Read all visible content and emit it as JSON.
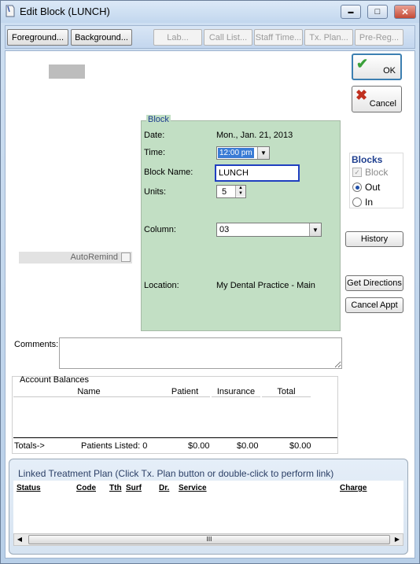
{
  "window": {
    "title": "Edit Block (LUNCH)",
    "controls": {
      "minimize": "▬",
      "maximize": "□",
      "close": "✕"
    }
  },
  "toolbar": {
    "foreground": "Foreground...",
    "background": "Background...",
    "lab": "Lab...",
    "call_list": "Call List...",
    "staff_time": "Staff Time...",
    "tx_plan": "Tx. Plan...",
    "pre_reg": "Pre-Reg..."
  },
  "actions": {
    "ok": "OK",
    "cancel": "Cancel",
    "ok_icon": "✔",
    "cancel_icon": "✖"
  },
  "block": {
    "legend": "Block",
    "date_label": "Date:",
    "date_value": "Mon., Jan. 21, 2013",
    "time_label": "Time:",
    "time_value": "12:00 pm",
    "name_label": "Block Name:",
    "name_value": "LUNCH",
    "units_label": "Units:",
    "units_value": "5",
    "column_label": "Column:",
    "column_value": "03",
    "location_label": "Location:",
    "location_value": "My Dental Practice - Main"
  },
  "autoremind": "AutoRemind",
  "blocks": {
    "title": "Blocks",
    "block": "Block",
    "out": "Out",
    "in": "In",
    "selected": "Out"
  },
  "side_buttons": {
    "history": "History",
    "get_directions": "Get Directions",
    "cancel_appt": "Cancel Appt"
  },
  "comments": {
    "label": "Comments:",
    "value": ""
  },
  "account_balances": {
    "title": "Account Balances",
    "headers": [
      "Name",
      "Patient",
      "Insurance",
      "Total"
    ],
    "totals_label": "Totals->",
    "patients_listed": "Patients Listed: 0",
    "patient_total": "$0.00",
    "insurance_total": "$0.00",
    "total": "$0.00"
  },
  "linked_plan": {
    "title": "Linked Treatment Plan (Click Tx. Plan button or double-click to perform link)",
    "headers": [
      "Status",
      "Code",
      "Tth",
      "Surf",
      "Dr.",
      "Service",
      "Charge"
    ],
    "scroll_grip": "III"
  },
  "colors": {
    "block_panel": "#c2dfc4",
    "accent": "#1f3f8f",
    "focus": "#1f3fbf"
  }
}
